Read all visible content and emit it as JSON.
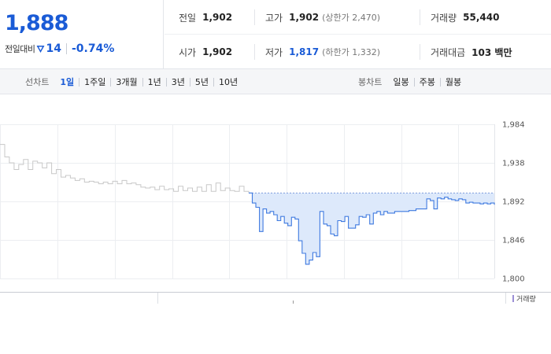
{
  "quote": {
    "price": "1,888",
    "change_label": "전일대비",
    "change_value": "14",
    "change_pct": "-0.74%"
  },
  "stats": {
    "prev_close": {
      "label": "전일",
      "value": "1,902"
    },
    "high": {
      "label": "고가",
      "value": "1,902",
      "sub": "(상한가 2,470)"
    },
    "volume": {
      "label": "거래량",
      "value": "55,440"
    },
    "open": {
      "label": "시가",
      "value": "1,902"
    },
    "low": {
      "label": "저가",
      "value": "1,817",
      "sub": "(하한가 1,332)"
    },
    "trade_amount": {
      "label": "거래대금",
      "value": "103 백만"
    }
  },
  "toolbar": {
    "line_chart_title": "선차트",
    "line_periods": [
      "1일",
      "1주일",
      "3개월",
      "1년",
      "3년",
      "5년",
      "10년"
    ],
    "active_period": "1일",
    "candle_chart_title": "봉차트",
    "candle_periods": [
      "일봉",
      "주봉",
      "월봉"
    ]
  },
  "volume_panel": {
    "legend": "거래량"
  },
  "colors": {
    "accent": "#1a5bd6",
    "line_prev": "#c8c8c8",
    "line_today": "#3f7ae0",
    "area_fill": "#dde9fb"
  },
  "chart_data": {
    "type": "line",
    "ylim": [
      1800,
      1984
    ],
    "yticks": [
      "1,984",
      "1,938",
      "1,892",
      "1,846",
      "1,800"
    ],
    "ytick_values": [
      1984,
      1938,
      1892,
      1846,
      1800
    ],
    "baseline": 1902,
    "grid": true,
    "series": [
      {
        "values": [
          1960,
          1945,
          1938,
          1930,
          1936,
          1942,
          1930,
          1940,
          1938,
          1932,
          1938,
          1925,
          1930,
          1921,
          1923,
          1920,
          1917,
          1919,
          1915,
          1916,
          1915,
          1913,
          1915,
          1913,
          1916,
          1913,
          1917,
          1913,
          1914,
          1912,
          1909,
          1908,
          1909,
          1906,
          1910,
          1906,
          1907,
          1904,
          1910,
          1905,
          1908,
          1904,
          1909,
          1904,
          1912,
          1904,
          1914,
          1905,
          1908,
          1905,
          1904,
          1910,
          1904,
          1902
        ]
      },
      {
        "values": [
          1902,
          1890,
          1885,
          1856,
          1883,
          1878,
          1880,
          1876,
          1869,
          1874,
          1866,
          1863,
          1873,
          1871,
          1845,
          1830,
          1817,
          1822,
          1831,
          1826,
          1880,
          1865,
          1863,
          1853,
          1851,
          1869,
          1868,
          1874,
          1860,
          1860,
          1864,
          1874,
          1873,
          1876,
          1865,
          1878,
          1880,
          1876,
          1880,
          1878,
          1878,
          1880,
          1880,
          1880,
          1880,
          1881,
          1881,
          1883,
          1883,
          1883,
          1895,
          1893,
          1883,
          1896,
          1895,
          1897,
          1895,
          1894,
          1893,
          1895,
          1894,
          1890,
          1891,
          1890,
          1890,
          1889,
          1890,
          1889,
          1890,
          1888
        ]
      }
    ]
  }
}
